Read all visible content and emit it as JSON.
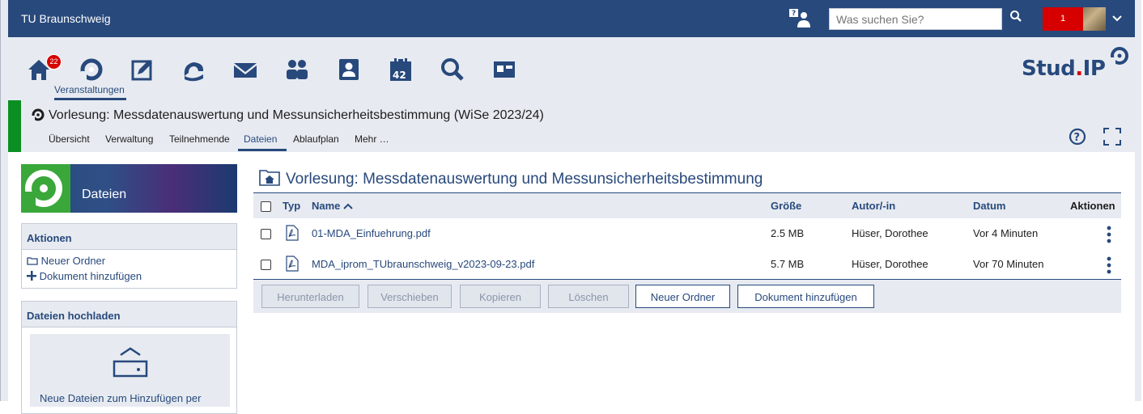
{
  "topbar": {
    "institution": "TU Braunschweig",
    "search_placeholder": "Was suchen Sie?",
    "notification_count": "1"
  },
  "nav": {
    "items": [
      {
        "icon": "home-icon",
        "badge": "22"
      },
      {
        "icon": "courses-icon",
        "label": "Veranstaltungen",
        "active": true
      },
      {
        "icon": "messages-board-icon"
      },
      {
        "icon": "community-icon"
      },
      {
        "icon": "mail-icon"
      },
      {
        "icon": "people-icon"
      },
      {
        "icon": "profile-icon"
      },
      {
        "icon": "calendar-icon",
        "text": "42"
      },
      {
        "icon": "search-icon"
      },
      {
        "icon": "tools-icon"
      }
    ],
    "logo": {
      "part1": "Stud",
      "dot": ".",
      "part2": "IP"
    }
  },
  "context": {
    "title": "Vorlesung: Messdatenauswertung und Messunsicherheitsbestimmung (WiSe 2023/24)",
    "tabs": [
      "Übersicht",
      "Verwaltung",
      "Teilnehmende",
      "Dateien",
      "Ablaufplan",
      "Mehr …"
    ],
    "active_tab": "Dateien"
  },
  "sidebar": {
    "header_title": "Dateien",
    "actions_title": "Aktionen",
    "actions": [
      "Neuer Ordner",
      "Dokument hinzufügen"
    ],
    "upload_title": "Dateien hochladen",
    "upload_text": "Neue Dateien zum Hinzufügen per"
  },
  "main": {
    "folder_title": "Vorlesung: Messdatenauswertung und Messunsicherheitsbestimmung",
    "columns": {
      "type": "Typ",
      "name": "Name",
      "size": "Größe",
      "author": "Autor/-in",
      "date": "Datum",
      "actions": "Aktionen"
    },
    "files": [
      {
        "name": "01-MDA_Einfuehrung.pdf",
        "size": "2.5 MB",
        "author": "Hüser, Dorothee",
        "date": "Vor 4 Minuten"
      },
      {
        "name": "MDA_iprom_TUbraunschweig_v2023-09-23.pdf",
        "size": "5.7 MB",
        "author": "Hüser, Dorothee",
        "date": "Vor 70 Minuten"
      }
    ],
    "buttons": {
      "download": "Herunterladen",
      "move": "Verschieben",
      "copy": "Kopieren",
      "delete": "Löschen",
      "new_folder": "Neuer Ordner",
      "add_document": "Dokument hinzufügen"
    }
  },
  "colors": {
    "brand": "#28497c",
    "accent_red": "#d60000",
    "course_green": "#0b8f23",
    "panel_bg": "#e7ebf1"
  }
}
